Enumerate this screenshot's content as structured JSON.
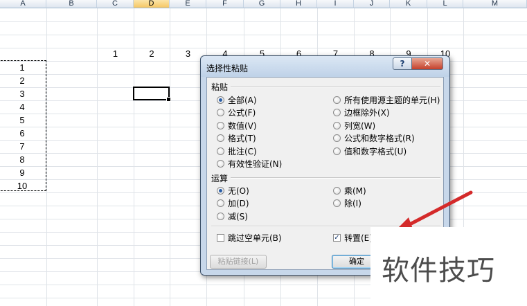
{
  "sheet": {
    "columns": [
      "A",
      "B",
      "C",
      "D",
      "E",
      "F",
      "G",
      "H",
      "I",
      "J",
      "K",
      "L",
      "M"
    ],
    "active_column": "D",
    "row_numbers": [
      "1",
      "2",
      "3",
      "4",
      "5",
      "6",
      "7",
      "8",
      "9",
      "10"
    ],
    "pasted_row_values": [
      "1",
      "2",
      "3",
      "4",
      "5",
      "6",
      "7",
      "8",
      "9",
      "10"
    ],
    "column_a_values": [
      "1",
      "2",
      "3",
      "4",
      "5",
      "6",
      "7",
      "8",
      "9",
      "10"
    ]
  },
  "dialog": {
    "title": "选择性粘贴",
    "help_label": "?",
    "close_label": "✕",
    "paste_section": "粘贴",
    "paste_options_left": [
      "全部(A)",
      "公式(F)",
      "数值(V)",
      "格式(T)",
      "批注(C)",
      "有效性验证(N)"
    ],
    "paste_options_right": [
      "所有使用源主题的单元(H)",
      "边框除外(X)",
      "列宽(W)",
      "公式和数字格式(R)",
      "值和数字格式(U)"
    ],
    "paste_selected": "全部(A)",
    "operation_section": "运算",
    "operation_options_left": [
      "无(O)",
      "加(D)",
      "减(S)"
    ],
    "operation_options_right": [
      "乘(M)",
      "除(I)"
    ],
    "operation_selected": "无(O)",
    "skip_blanks_label": "跳过空单元(B)",
    "skip_blanks_checked": false,
    "transpose_label": "转置(E)",
    "transpose_checked": true,
    "paste_link_label": "粘贴链接(L)",
    "ok_label": "确定"
  },
  "watermark": {
    "text": "软件技巧"
  },
  "colors": {
    "arrow": "#d42a2a",
    "accent": "#2b5fa8",
    "active_col": "#f5c765"
  }
}
